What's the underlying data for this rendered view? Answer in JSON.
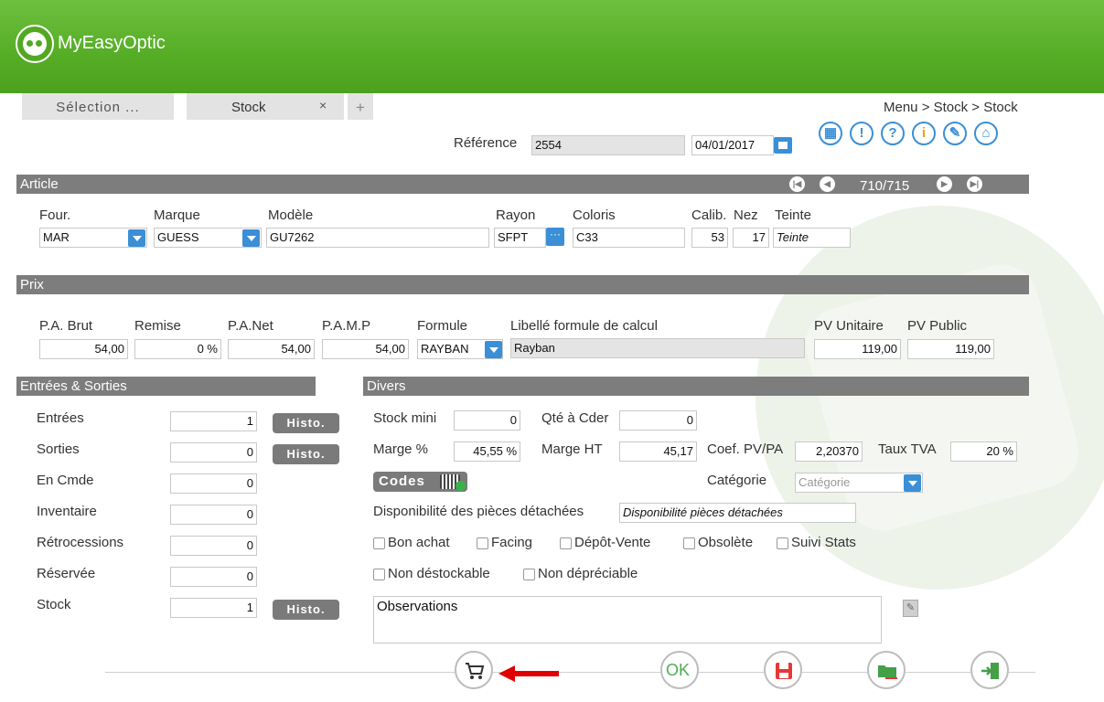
{
  "app": {
    "name": "MyEasyOptic"
  },
  "tabs": [
    {
      "label": "Sélection ..."
    },
    {
      "label": "Stock",
      "close": "×"
    },
    {
      "label": "+"
    }
  ],
  "breadcrumb": "Menu > Stock > Stock",
  "reference": {
    "label": "Référence",
    "value": "2554",
    "date": "04/01/2017"
  },
  "top_icons": [
    "calculator-icon",
    "alert-icon",
    "help-icon",
    "info-icon",
    "tools-icon",
    "home-icon"
  ],
  "article": {
    "title": "Article",
    "counter": "710/715",
    "labels": {
      "four": "Four.",
      "marque": "Marque",
      "modele": "Modèle",
      "rayon": "Rayon",
      "coloris": "Coloris",
      "calib": "Calib.",
      "nez": "Nez",
      "teinte": "Teinte"
    },
    "values": {
      "four": "MAR",
      "marque": "GUESS",
      "modele": "GU7262",
      "rayon": "SFPT",
      "coloris": "C33",
      "calib": "53",
      "nez": "17",
      "teinte": "Teinte"
    }
  },
  "prix": {
    "title": "Prix",
    "labels": {
      "pa_brut": "P.A. Brut",
      "remise": "Remise",
      "pa_net": "P.A.Net",
      "pamp": "P.A.M.P",
      "formule": "Formule",
      "libelle": "Libellé formule de calcul",
      "pv_unitaire": "PV Unitaire",
      "pv_public": "PV Public"
    },
    "values": {
      "pa_brut": "54,00",
      "remise": "0 %",
      "pa_net": "54,00",
      "pamp": "54,00",
      "formule": "RAYBAN",
      "libelle": "Rayban",
      "pv_unitaire": "119,00",
      "pv_public": "119,00"
    }
  },
  "entrees_sorties": {
    "title": "Entrées & Sorties",
    "histo_label": "Histo.",
    "rows": [
      {
        "label": "Entrées",
        "value": "1"
      },
      {
        "label": "Sorties",
        "value": "0"
      },
      {
        "label": "En Cmde",
        "value": "0"
      },
      {
        "label": "Inventaire",
        "value": "0"
      },
      {
        "label": "Rétrocessions",
        "value": "0"
      },
      {
        "label": "Réservée",
        "value": "0"
      },
      {
        "label": "Stock",
        "value": "1"
      }
    ]
  },
  "divers": {
    "title": "Divers",
    "stock_mini": {
      "label": "Stock mini",
      "value": "0"
    },
    "qte_cder": {
      "label": "Qté à Cder",
      "value": "0"
    },
    "marge_pct": {
      "label": "Marge %",
      "value": "45,55 %"
    },
    "marge_ht": {
      "label": "Marge HT",
      "value": "45,17"
    },
    "coef": {
      "label": "Coef. PV/PA",
      "value": "2,20370"
    },
    "tva": {
      "label": "Taux TVA",
      "value": "20 %"
    },
    "codes_label": "Codes",
    "categorie": {
      "label": "Catégorie",
      "placeholder": "Catégorie"
    },
    "dispo": {
      "label": "Disponibilité des pièces détachées",
      "value": "Disponibilité pièces détachées"
    },
    "checkboxes": [
      {
        "label": "Bon achat"
      },
      {
        "label": "Facing"
      },
      {
        "label": "Dépôt-Vente"
      },
      {
        "label": "Obsolète"
      },
      {
        "label": "Suivi Stats"
      },
      {
        "label": "Non déstockable"
      },
      {
        "label": "Non dépréciable"
      }
    ],
    "observations": "Observations"
  },
  "bottom_buttons": {
    "ok_label": "OK",
    "icons": [
      "cart-icon",
      "ok-icon",
      "save-icon",
      "folder-icon",
      "exit-icon"
    ]
  },
  "colors": {
    "header_green": "#55ad25",
    "accent_blue": "#3b8fd6",
    "section_gray": "#7d7d7d",
    "arrow_red": "#e00000"
  }
}
